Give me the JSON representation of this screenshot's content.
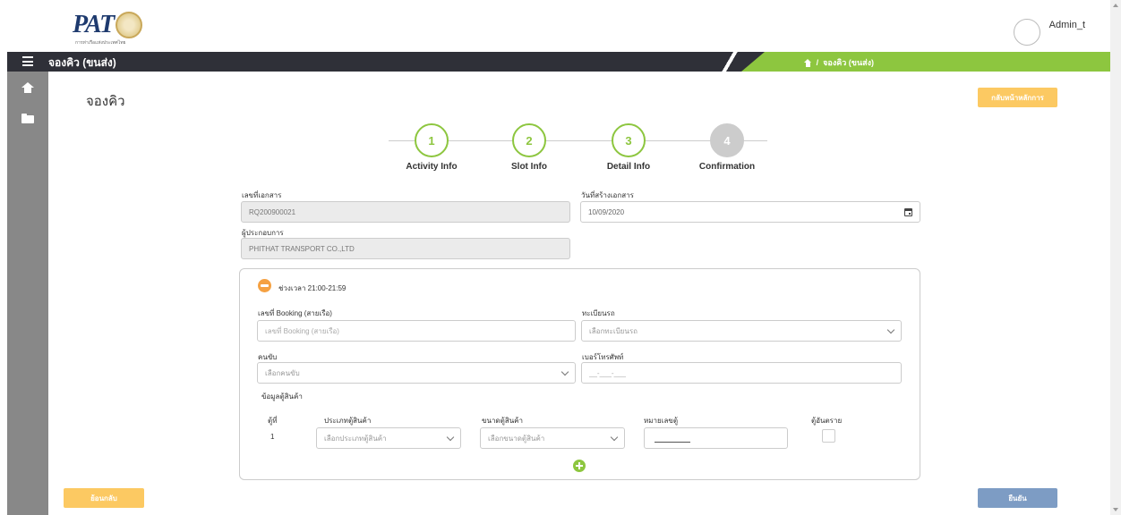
{
  "header": {
    "logo_text": "PAT",
    "logo_subtext": "การท่าเรือแห่งประเทศไทย",
    "user_name": "Admin_t"
  },
  "navbar": {
    "title": "จองคิว (ขนส่ง)",
    "breadcrumb_current": "จองคิว (ขนส่ง)",
    "breadcrumb_separator": "/"
  },
  "page": {
    "title": "จองคิว",
    "back_to_main_label": "กลับหน้าหลักการ",
    "prev_label": "ย้อนกลับ",
    "confirm_label": "ยืนยัน"
  },
  "stepper": {
    "steps": [
      {
        "number": "1",
        "label": "Activity Info",
        "state": "active"
      },
      {
        "number": "2",
        "label": "Slot Info",
        "state": "active"
      },
      {
        "number": "3",
        "label": "Detail Info",
        "state": "active"
      },
      {
        "number": "4",
        "label": "Confirmation",
        "state": "inactive"
      }
    ]
  },
  "document": {
    "doc_no_label": "เลขที่เอกสาร",
    "doc_no_value": "RQ200900021",
    "created_date_label": "วันที่สร้างเอกสาร",
    "created_date_value": "10/09/2020",
    "operator_label": "ผู้ประกอบการ",
    "operator_value": "PHITHAT TRANSPORT CO.,LTD"
  },
  "slot": {
    "time_range_label": "ช่วงเวลา 21:00-21:59",
    "booking_label": "เลขที่ Booking (สายเรือ)",
    "booking_placeholder": "เลขที่ Booking (สายเรือ)",
    "plate_label": "ทะเบียนรถ",
    "plate_placeholder": "เลือกทะเบียนรถ",
    "driver_label": "คนขับ",
    "driver_placeholder": "เลือกคนขับ",
    "phone_label": "เบอร์โทรศัพท์",
    "phone_placeholder": "__-___-___",
    "container_section_label": "ข้อมูลตู้สินค้า",
    "container_table": {
      "col_no": "ตู้ที่",
      "col_type": "ประเภทตู้สินค้า",
      "col_size": "ขนาดตู้สินค้า",
      "col_number": "หมายเลขตู้",
      "col_hazard": "ตู้อันตราย",
      "rows": [
        {
          "no": "1",
          "type_placeholder": "เลือกประเภทตู้สินค้า",
          "size_placeholder": "เลือกขนาดตู้สินค้า"
        }
      ]
    }
  },
  "colors": {
    "accent_green": "#8dc63f",
    "nav_dark": "#2f3038",
    "button_yellow": "#fcc962",
    "button_blue": "#7d9cc4",
    "minus_orange": "#f5a142"
  }
}
